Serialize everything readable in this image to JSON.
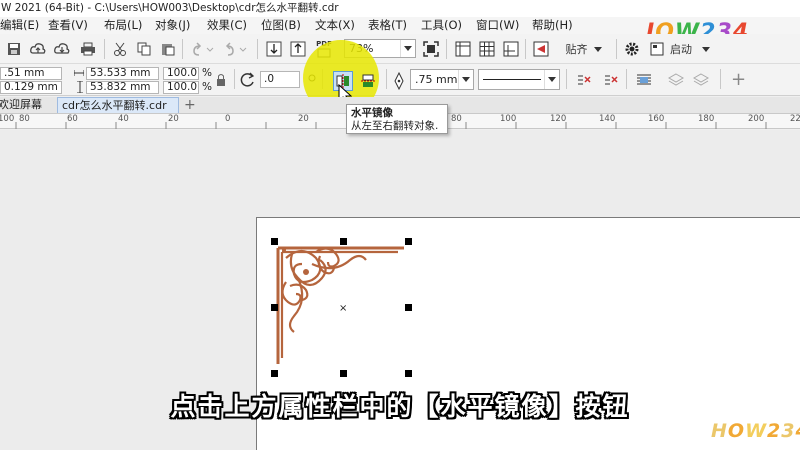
{
  "app": {
    "title": "W 2021 (64-Bit) - C:\\Users\\HOW003\\Desktop\\cdr怎么水平翻转.cdr"
  },
  "menu": {
    "items": [
      {
        "key": "edit",
        "label": "编辑(E)"
      },
      {
        "key": "view",
        "label": "查看(V)"
      },
      {
        "key": "layout",
        "label": "布局(L)"
      },
      {
        "key": "object",
        "label": "对象(J)"
      },
      {
        "key": "effects",
        "label": "效果(C)"
      },
      {
        "key": "bitmaps",
        "label": "位图(B)"
      },
      {
        "key": "text",
        "label": "文本(X)"
      },
      {
        "key": "table",
        "label": "表格(T)"
      },
      {
        "key": "tools",
        "label": "工具(O)"
      },
      {
        "key": "window",
        "label": "窗口(W)"
      },
      {
        "key": "help",
        "label": "帮助(H)"
      }
    ]
  },
  "toolbar": {
    "pdf_label": "PDF",
    "zoom_value": "73%",
    "snap_label": "贴齐",
    "launch_label": "启动"
  },
  "properties": {
    "x_value": ".51 mm",
    "y_value": "0.129 mm",
    "width_value": "53.533 mm",
    "height_value": "53.832 mm",
    "scale_x": "100.0",
    "scale_y": "100.0",
    "percent_symbol": "%",
    "rotation_value": ".0",
    "outline_width": ".75 mm"
  },
  "tabs": {
    "welcome_label": "欢迎屏幕",
    "document_label": "cdr怎么水平翻转.cdr",
    "add_label": "+"
  },
  "ruler": {
    "labels": [
      "100",
      "80",
      "60",
      "40",
      "20",
      "0",
      "20",
      "40",
      "60",
      "80",
      "100",
      "120",
      "140",
      "160",
      "180",
      "200",
      "220"
    ]
  },
  "tooltip": {
    "title": "水平镜像",
    "description": "从左至右翻转对象."
  },
  "caption": {
    "text": "点击上方属性栏中的【水平镜像】按钮"
  },
  "watermark": {
    "text": "HOW234"
  },
  "colors": {
    "highlight": "#e6e600",
    "ornament": "#b5653d",
    "active_tab": "#dbe8f8"
  }
}
